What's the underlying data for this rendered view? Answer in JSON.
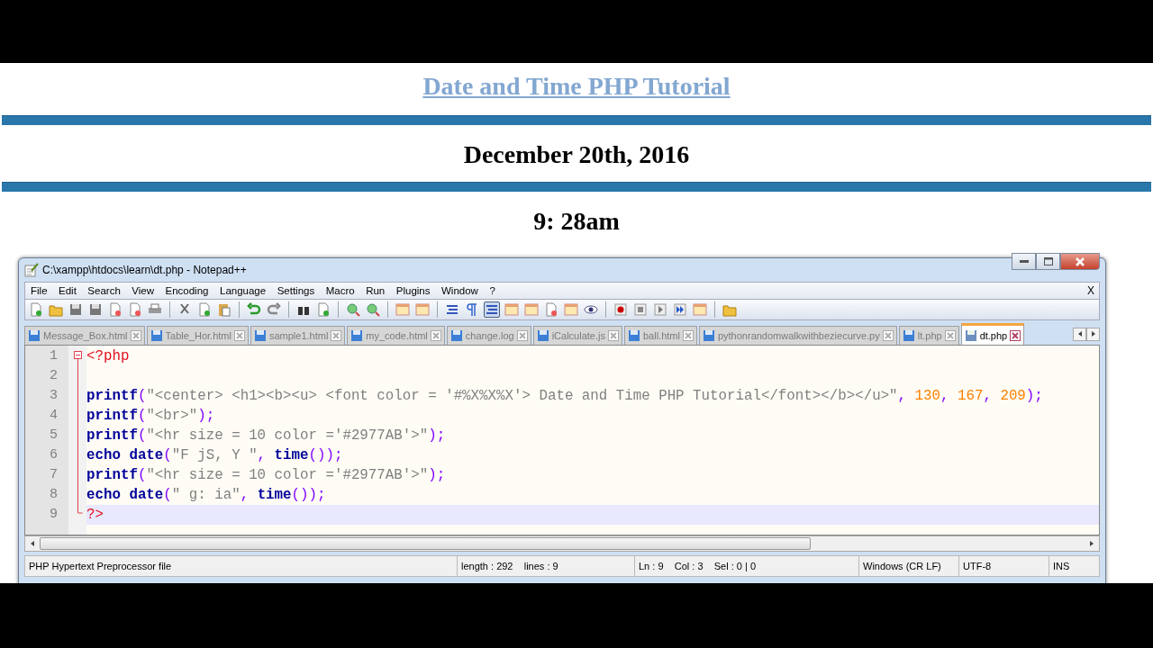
{
  "page": {
    "heading_link": "Date and Time PHP Tutorial",
    "date": "December 20th, 2016",
    "time": "9: 28am"
  },
  "window": {
    "title": "C:\\xampp\\htdocs\\learn\\dt.php - Notepad++",
    "menu": [
      "File",
      "Edit",
      "Search",
      "View",
      "Encoding",
      "Language",
      "Settings",
      "Macro",
      "Run",
      "Plugins",
      "Window",
      "?"
    ],
    "menu_close": "X",
    "tabs": [
      {
        "label": "Message_Box.html",
        "selected": false
      },
      {
        "label": "Table_Hor.html",
        "selected": false
      },
      {
        "label": "sample1.html",
        "selected": false
      },
      {
        "label": "my_code.html",
        "selected": false
      },
      {
        "label": "change.log",
        "selected": false
      },
      {
        "label": "iCalculate.js",
        "selected": false
      },
      {
        "label": "ball.html",
        "selected": false
      },
      {
        "label": "pythonrandomwalkwithbeziecurve.py",
        "selected": false
      },
      {
        "label": "lt.php",
        "selected": false
      },
      {
        "label": "dt.php",
        "selected": true
      }
    ],
    "lines": [
      {
        "number": "1",
        "current": false,
        "tokens": [
          {
            "kind": "tag",
            "text": "<?php"
          }
        ]
      },
      {
        "number": "2",
        "current": false
      },
      {
        "number": "3",
        "current": false,
        "tokens": [
          {
            "kind": "keyword",
            "text": "printf"
          },
          {
            "kind": "punct",
            "text": "("
          },
          {
            "kind": "string",
            "text": "\"<center> <h1><b><u> <font color = '#%X%X%X'> Date and Time PHP Tutorial</font></b></u>\""
          },
          {
            "kind": "punct",
            "text": ", "
          },
          {
            "kind": "number",
            "text": "130"
          },
          {
            "kind": "punct",
            "text": ", "
          },
          {
            "kind": "number",
            "text": "167"
          },
          {
            "kind": "punct",
            "text": ", "
          },
          {
            "kind": "number",
            "text": "209"
          },
          {
            "kind": "punct",
            "text": ");"
          }
        ]
      },
      {
        "number": "4",
        "current": false,
        "tokens": [
          {
            "kind": "keyword",
            "text": "printf"
          },
          {
            "kind": "punct",
            "text": "("
          },
          {
            "kind": "string",
            "text": "\"<br>\""
          },
          {
            "kind": "punct",
            "text": ");"
          }
        ]
      },
      {
        "number": "5",
        "current": false,
        "tokens": [
          {
            "kind": "keyword",
            "text": "printf"
          },
          {
            "kind": "punct",
            "text": "("
          },
          {
            "kind": "string",
            "text": "\"<hr size = 10 color ='#2977AB'>\""
          },
          {
            "kind": "punct",
            "text": ");"
          }
        ]
      },
      {
        "number": "6",
        "current": false,
        "tokens": [
          {
            "kind": "keyword",
            "text": "echo date"
          },
          {
            "kind": "punct",
            "text": "("
          },
          {
            "kind": "string",
            "text": "\"F jS, Y \""
          },
          {
            "kind": "punct",
            "text": ", "
          },
          {
            "kind": "keyword",
            "text": "time"
          },
          {
            "kind": "punct",
            "text": "());"
          }
        ]
      },
      {
        "number": "7",
        "current": false,
        "tokens": [
          {
            "kind": "keyword",
            "text": "printf"
          },
          {
            "kind": "punct",
            "text": "("
          },
          {
            "kind": "string",
            "text": "\"<hr size = 10 color ='#2977AB'>\""
          },
          {
            "kind": "punct",
            "text": ");"
          }
        ]
      },
      {
        "number": "8",
        "current": false,
        "tokens": [
          {
            "kind": "keyword",
            "text": "echo date"
          },
          {
            "kind": "punct",
            "text": "("
          },
          {
            "kind": "string",
            "text": "\" g: ia\""
          },
          {
            "kind": "punct",
            "text": ", "
          },
          {
            "kind": "keyword",
            "text": "time"
          },
          {
            "kind": "punct",
            "text": "());"
          }
        ]
      },
      {
        "number": "9",
        "current": true,
        "tokens": [
          {
            "kind": "tag",
            "text": "?>"
          }
        ]
      }
    ],
    "status_bar": [
      "PHP Hypertext Preprocessor file",
      "length : 292    lines : 9",
      "Ln : 9    Col : 3    Sel : 0 | 0",
      "Windows (CR LF)",
      "UTF-8",
      "INS"
    ]
  }
}
